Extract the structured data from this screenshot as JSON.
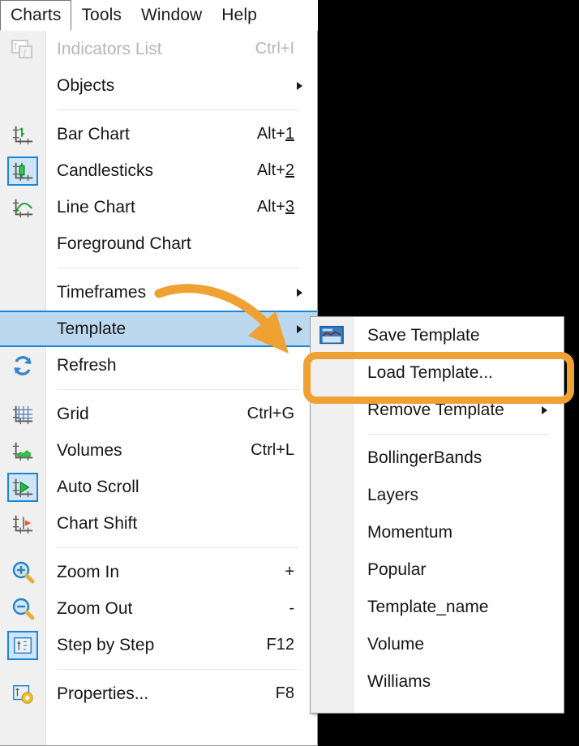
{
  "menubar": {
    "tabs": [
      {
        "label": "Charts",
        "active": true
      },
      {
        "label": "Tools",
        "active": false
      },
      {
        "label": "Window",
        "active": false
      },
      {
        "label": "Help",
        "active": false
      }
    ]
  },
  "menu": {
    "items": [
      {
        "label": "Indicators List",
        "accel": "Ctrl+I",
        "icon": "indicators-list-icon",
        "disabled": true,
        "arrow": false
      },
      {
        "label": "Objects",
        "accel": "",
        "icon": "",
        "disabled": false,
        "arrow": true
      },
      {
        "separator": true
      },
      {
        "label": "Bar Chart",
        "accel": "Alt+1",
        "accel_underline": "1",
        "icon": "bar-chart-icon",
        "disabled": false,
        "arrow": false
      },
      {
        "label": "Candlesticks",
        "accel": "Alt+2",
        "accel_underline": "2",
        "icon": "candlesticks-icon",
        "icon_active": true,
        "disabled": false,
        "arrow": false
      },
      {
        "label": "Line Chart",
        "accel": "Alt+3",
        "accel_underline": "3",
        "icon": "line-chart-icon",
        "disabled": false,
        "arrow": false
      },
      {
        "label": "Foreground Chart",
        "accel": "",
        "icon": "",
        "disabled": false,
        "arrow": false
      },
      {
        "separator": true
      },
      {
        "label": "Timeframes",
        "accel": "",
        "icon": "",
        "disabled": false,
        "arrow": true
      },
      {
        "label": "Template",
        "accel": "",
        "icon": "",
        "disabled": false,
        "arrow": true,
        "selected": true
      },
      {
        "label": "Refresh",
        "accel": "",
        "icon": "refresh-icon",
        "disabled": false,
        "arrow": false
      },
      {
        "separator": true
      },
      {
        "label": "Grid",
        "accel": "Ctrl+G",
        "icon": "grid-icon",
        "disabled": false,
        "arrow": false
      },
      {
        "label": "Volumes",
        "accel": "Ctrl+L",
        "icon": "volumes-icon",
        "disabled": false,
        "arrow": false
      },
      {
        "label": "Auto Scroll",
        "accel": "",
        "icon": "auto-scroll-icon",
        "icon_active": true,
        "disabled": false,
        "arrow": false
      },
      {
        "label": "Chart Shift",
        "accel": "",
        "icon": "chart-shift-icon",
        "disabled": false,
        "arrow": false
      },
      {
        "separator": true
      },
      {
        "label": "Zoom In",
        "accel": "+",
        "icon": "zoom-in-icon",
        "disabled": false,
        "arrow": false
      },
      {
        "label": "Zoom Out",
        "accel": "-",
        "icon": "zoom-out-icon",
        "disabled": false,
        "arrow": false
      },
      {
        "label": "Step by Step",
        "accel": "F12",
        "icon": "step-by-step-icon",
        "icon_active": true,
        "disabled": false,
        "arrow": false
      },
      {
        "separator": true
      },
      {
        "label": "Properties...",
        "accel": "F8",
        "icon": "properties-icon",
        "disabled": false,
        "arrow": false
      }
    ]
  },
  "submenu": {
    "items": [
      {
        "label": "Save Template",
        "icon": "save-template-icon",
        "arrow": false
      },
      {
        "label": "Load Template...",
        "icon": "",
        "arrow": false,
        "highlighted": true
      },
      {
        "label": "Remove Template",
        "icon": "",
        "arrow": true
      },
      {
        "separator": true
      },
      {
        "label": "BollingerBands",
        "icon": "",
        "arrow": false
      },
      {
        "label": "Layers",
        "icon": "",
        "arrow": false
      },
      {
        "label": "Momentum",
        "icon": "",
        "arrow": false
      },
      {
        "label": "Popular",
        "icon": "",
        "arrow": false
      },
      {
        "label": "Template_name",
        "icon": "",
        "arrow": false
      },
      {
        "label": "Volume",
        "icon": "",
        "arrow": false
      },
      {
        "label": "Williams",
        "icon": "",
        "arrow": false
      }
    ]
  },
  "annotations": {
    "highlight_color": "#efa133",
    "arrow_color": "#efa133",
    "arrow_name": "pointer-arrow",
    "highlight_target": "Load Template..."
  },
  "colors": {
    "selection_fill": "#bcd8ef",
    "selection_border": "#1b85d6",
    "gutter": "#f0f0f0",
    "background": "#000000",
    "menu_background": "#ffffff",
    "text": "#161616",
    "disabled_text": "#b6b6b6"
  }
}
